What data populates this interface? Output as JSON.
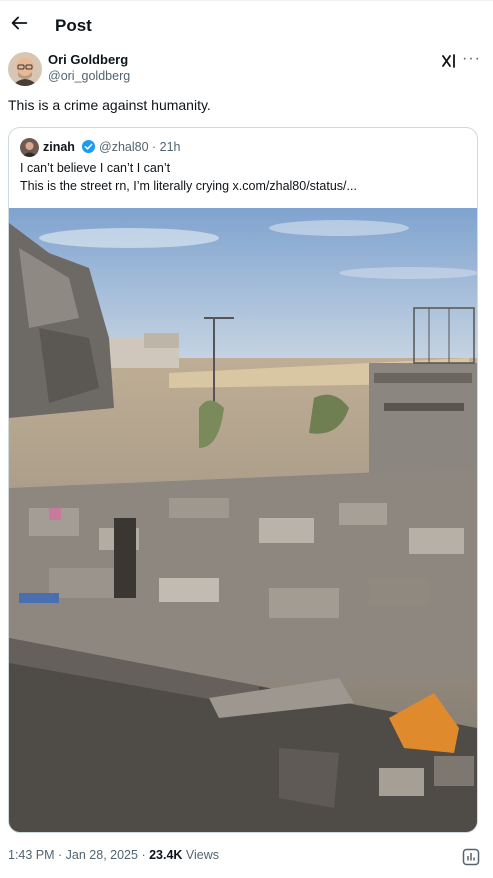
{
  "header": {
    "title": "Post"
  },
  "post": {
    "author_name": "Ori Goldberg",
    "author_handle": "@ori_goldberg",
    "text": "This is a crime against humanity.",
    "time": "1:43 PM",
    "date": "Jan 28, 2025",
    "views_count": "23.4K",
    "views_label": "Views"
  },
  "quote": {
    "author_name": "zinah",
    "author_handle": "@zhal80",
    "age": "21h",
    "line1": "I can’t believe I can’t I can’t",
    "line2": "This is the street rn, I’m literally crying  x.com/zhal80/status/..."
  },
  "icons": {
    "back": "arrow-left-icon",
    "grok": "grok-icon",
    "more": "more-icon",
    "verified": "verified-badge-icon",
    "analytics": "analytics-icon"
  },
  "colors": {
    "accent": "#1d9bf0",
    "text": "#0f1419",
    "secondary": "#536471",
    "border": "#cfd9de"
  }
}
